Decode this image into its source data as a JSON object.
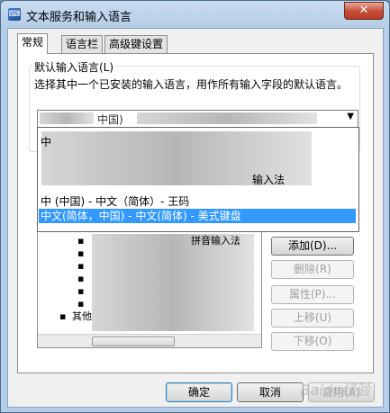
{
  "window": {
    "title": "文本服务和输入语言",
    "close_glyph": "✕",
    "app_icon": "keyboard-icon"
  },
  "tabs": [
    {
      "label": "常规",
      "active": true
    },
    {
      "label": "语言栏",
      "active": false
    },
    {
      "label": "高级键设置",
      "active": false
    }
  ],
  "default_language": {
    "group_title": "默认输入语言(L)",
    "description": "选择其中一个已安装的输入语言，用作所有输入字段的默认语言。",
    "combo_value": "中国)",
    "arrow_glyph": "▼"
  },
  "dropdown": {
    "items": [
      {
        "label": "中",
        "selected": false
      },
      {
        "label": "输入法",
        "selected": false
      },
      {
        "label": "中      (中国)  -  中文（简体）- 王码",
        "selected": false
      },
      {
        "label": "中文(简体，中国) - 中文(简体) - 美式键盘",
        "selected": true
      }
    ]
  },
  "tree": {
    "lines": [
      "",
      "",
      "",
      "",
      "",
      "",
      "拼音输入法",
      "",
      "",
      "",
      "",
      "其他"
    ],
    "bullet": "▪"
  },
  "buttons": {
    "add": "添加(D)...",
    "remove": "删除(R)",
    "properties": "属性(P)...",
    "move_up": "上移(U)",
    "move_down": "下移(O)"
  },
  "bottom": {
    "ok": "确定",
    "cancel": "取消",
    "apply": "应用(A)"
  },
  "watermark": "Baidu经验"
}
